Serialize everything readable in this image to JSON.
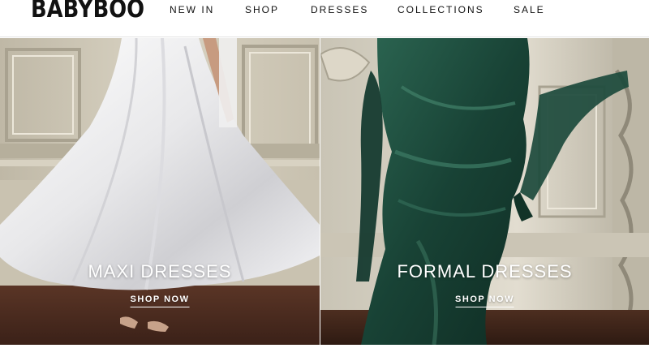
{
  "brand": {
    "logo_text": "BABYBOO"
  },
  "nav": {
    "items": [
      {
        "label": "NEW IN"
      },
      {
        "label": "SHOP"
      },
      {
        "label": "DRESSES"
      },
      {
        "label": "COLLECTIONS"
      },
      {
        "label": "SALE"
      }
    ]
  },
  "hero": {
    "panels": [
      {
        "title": "MAXI DRESSES",
        "cta": "SHOP NOW",
        "dress_color": "#f1f1f1",
        "floor_color": "#4a2a1e"
      },
      {
        "title": "FORMAL DRESSES",
        "cta": "SHOP NOW",
        "dress_color": "#1d4a3c",
        "floor_color": "#3a2418"
      }
    ]
  }
}
